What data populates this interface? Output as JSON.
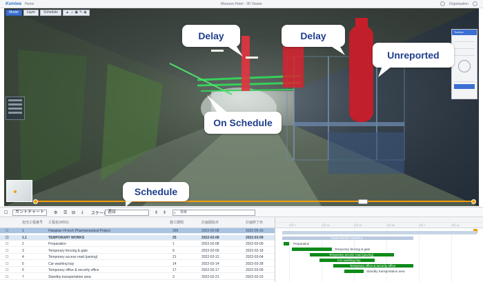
{
  "topbar": {
    "logo": "Kumiwa",
    "menu": "Home",
    "title": "Maruzen Hotel - 3D Viewer",
    "user": "Organization"
  },
  "viewport": {
    "toolbar": {
      "chips": [
        "Model",
        "Layer",
        "Schedule"
      ]
    },
    "callouts": {
      "delay1": "Delay",
      "delay2": "Delay",
      "unreported": "Unreported",
      "on_schedule": "On Schedule",
      "schedule": "Schedule"
    },
    "right_panel_header": "Toolbox"
  },
  "gantt_toolbar": {
    "view_select": "ガントチャート",
    "scale_label": "スケール",
    "scale_value": "週日",
    "search_placeholder": "検索"
  },
  "gantt": {
    "columns": [
      "担当工程番号",
      "工程名(WBS)",
      "施工期間",
      "計画開始日",
      "計画終了日"
    ],
    "rows": [
      {
        "id": "1",
        "name": "Hataplan Hi-tech Pharmaceutical Project",
        "days": "330",
        "start": "2022-02-08",
        "end": "2022-05-16",
        "style": "sel"
      },
      {
        "id": "1.1",
        "name": "TEMPORARY WORKS",
        "days": "25",
        "start": "2022-02-08",
        "end": "2022-03-09",
        "style": "group"
      },
      {
        "id": "2",
        "name": "Preparation",
        "days": "1",
        "start": "2022-02-08",
        "end": "2022-02-09",
        "style": ""
      },
      {
        "id": "3",
        "name": "Temporary fencing & gate",
        "days": "9",
        "start": "2022-02-09",
        "end": "2022-02-18",
        "style": ""
      },
      {
        "id": "4",
        "name": "Temporary access road (paving)",
        "days": "21",
        "start": "2022-02-12",
        "end": "2022-03-04",
        "style": ""
      },
      {
        "id": "5",
        "name": "Car washing bay",
        "days": "14",
        "start": "2022-02-14",
        "end": "2022-02-28",
        "style": ""
      },
      {
        "id": "6",
        "name": "Temporary office & security office",
        "days": "17",
        "start": "2022-02-17",
        "end": "2022-03-09",
        "style": ""
      },
      {
        "id": "7",
        "name": "Standby transportation area",
        "days": "3",
        "start": "2022-02-21",
        "end": "2022-02-23",
        "style": ""
      }
    ],
    "weeks": [
      "2月 7",
      "2月 14",
      "2月 21",
      "2月 28",
      "3月 7",
      "3月 14"
    ],
    "bar_labels": {
      "group": "TEMPORARY WORKS",
      "prep": "Preparation",
      "fence": "Temporary fencing & gate",
      "road": "Temporary access road (paving)",
      "car": "Car washing bay",
      "office": "Temporary office & security office",
      "standby": "Standby transportation area"
    }
  },
  "colors": {
    "accent": "#3b6fd1",
    "callout_text": "#1f3e8c",
    "gantt_bar": "#0f8a1a",
    "timeline": "#f59e0b"
  }
}
